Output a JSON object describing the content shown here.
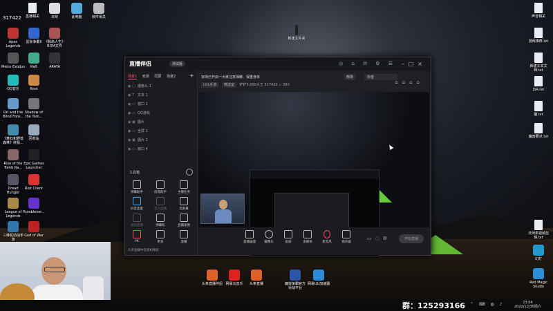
{
  "desktop": {
    "counter": "317422",
    "left_icons": [
      {
        "label": "Apex Legends"
      },
      {
        "label": "星际争霸II"
      },
      {
        "label": "《致命人生》ROM文件"
      },
      {
        "label": "Metro Exodus"
      },
      {
        "label": "Raft"
      },
      {
        "label": "ARAYA"
      },
      {
        "label": "QQ音乐"
      },
      {
        "label": "Root"
      },
      {
        "label": "Ori and the Blind Fore..."
      },
      {
        "label": "Shadow of the Tom..."
      },
      {
        "label": "《黄石和野兽森林》终极..."
      },
      {
        "label": "回收站"
      },
      {
        "label": "Rise of the Tomb Ra..."
      },
      {
        "label": "Epic Games Launcher"
      },
      {
        "label": "Dread Hunger"
      },
      {
        "label": "Riot Client"
      },
      {
        "label": "League of Legends"
      },
      {
        "label": "Rumblever..."
      },
      {
        "label": "三维机动战手游"
      },
      {
        "label": "God of War"
      }
    ],
    "top_icons": [
      {
        "label": "直播相关"
      },
      {
        "label": "日常"
      },
      {
        "label": "此电脑"
      },
      {
        "label": "软件相关"
      }
    ],
    "right_icons": [
      {
        "label": "声音相关"
      },
      {
        "label": "游戏推荐.txt"
      },
      {
        "label": "新建文本文档.txt"
      },
      {
        "label": "JSA.txt"
      },
      {
        "label": "猫.txt"
      },
      {
        "label": "魔兽要点.txt"
      },
      {
        "label": "法师类视频剪辑.txt"
      },
      {
        "label": "幻灯"
      },
      {
        "label": "Red Magic Studio"
      }
    ],
    "center_label": "新建文件夹"
  },
  "window": {
    "app_title": "直播伴侣",
    "version_badge": "测试版",
    "left_tabs": [
      "场景1",
      "双场",
      "同屏",
      "场景2"
    ],
    "scenes": [
      {
        "name": "摄像头 1"
      },
      {
        "name": "文本 1"
      },
      {
        "name": "窗口 1"
      },
      {
        "name": "QQ游戏"
      },
      {
        "name": "图片"
      },
      {
        "name": "全屏 1"
      },
      {
        "name": "图片 1"
      },
      {
        "name": "窗口 4"
      }
    ],
    "tools_title": "工具箱",
    "tools": [
      {
        "label": "弹幕助手"
      },
      {
        "label": "房管助手"
      },
      {
        "label": "主播任务"
      },
      {
        "label": "抖音连麦"
      },
      {
        "label": "无人直播"
      },
      {
        "label": "连屏幕"
      },
      {
        "label": "虚拟直播"
      },
      {
        "label": "弹幕机"
      },
      {
        "label": "直播录像"
      },
      {
        "label": "PK"
      },
      {
        "label": "更多"
      },
      {
        "label": "直播"
      }
    ],
    "status_text": "头条直播中连麦机精彩",
    "room_title": "双场已开启一大家注意保暖、保重身体",
    "room_tag1": "修改",
    "room_tag2": "抖音",
    "sub_chip1": "LOL手游",
    "sub_chip2": "精选室",
    "room_id_label": "铲铲3,000大王",
    "room_id": "317422",
    "viewers": "260",
    "bottom_tools": [
      {
        "label": "直播画面"
      },
      {
        "label": "摄像头"
      },
      {
        "label": "投屏"
      },
      {
        "label": "多媒体"
      },
      {
        "label": "麦克风"
      },
      {
        "label": "扬声器"
      }
    ],
    "go_live": "开始直播"
  },
  "taskbar": {
    "apps": [
      {
        "label": "头条直播伴侣"
      },
      {
        "label": "网易云音乐"
      },
      {
        "label": "头条直播"
      },
      {
        "label": "魔兽争霸官方对战平台"
      },
      {
        "label": "网易UU加速器"
      }
    ],
    "group_label": "群：125293166",
    "time": "23:04",
    "date": "2022/12/30周六"
  }
}
